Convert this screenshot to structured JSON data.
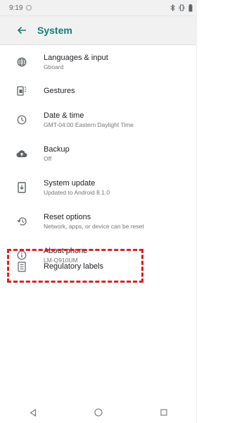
{
  "status_bar": {
    "time": "9:19"
  },
  "toolbar": {
    "title": "System"
  },
  "settings": [
    {
      "title": "Languages & input",
      "subtitle": "Gboard",
      "icon": "globe-icon"
    },
    {
      "title": "Gestures",
      "subtitle": "",
      "icon": "gestures-icon"
    },
    {
      "title": "Date & time",
      "subtitle": "GMT-04:00 Eastern Daylight Time",
      "icon": "clock-icon"
    },
    {
      "title": "Backup",
      "subtitle": "Off",
      "icon": "cloud-upload-icon"
    },
    {
      "title": "System update",
      "subtitle": "Updated to Android 8.1.0",
      "icon": "system-update-icon"
    },
    {
      "title": "Reset options",
      "subtitle": "Network, apps, or device can be reset",
      "icon": "restore-icon"
    },
    {
      "title": "About phone",
      "subtitle": "LM-Q910UM",
      "icon": "info-icon"
    },
    {
      "title": "Regulatory labels",
      "subtitle": "",
      "icon": "document-icon"
    }
  ],
  "highlight_color": "#e02020",
  "accent_color": "#1a7a75"
}
